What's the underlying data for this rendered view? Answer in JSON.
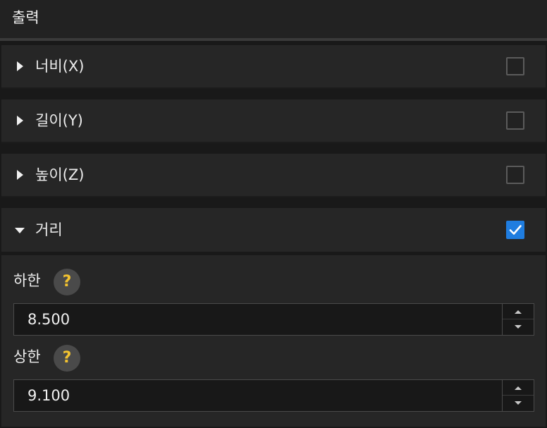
{
  "header": {
    "title": "출력"
  },
  "rows": [
    {
      "label": "너비(X)",
      "expanded": false,
      "checked": false
    },
    {
      "label": "길이(Y)",
      "expanded": false,
      "checked": false
    },
    {
      "label": "높이(Z)",
      "expanded": false,
      "checked": false
    },
    {
      "label": "거리",
      "expanded": true,
      "checked": true
    }
  ],
  "distance": {
    "lower": {
      "label": "하한",
      "help": "?",
      "value": "8.500"
    },
    "upper": {
      "label": "상한",
      "help": "?",
      "value": "9.100"
    }
  },
  "icons": {
    "collapsed": "caret-right-icon",
    "expanded": "caret-down-icon",
    "checkmark": "checkmark-icon",
    "help": "help-icon",
    "spin_up": "spin-up-icon",
    "spin_down": "spin-down-icon"
  },
  "colors": {
    "accent": "#1f7de0",
    "help_glyph": "#f2c230",
    "background": "#191919",
    "row_background": "#262626"
  }
}
